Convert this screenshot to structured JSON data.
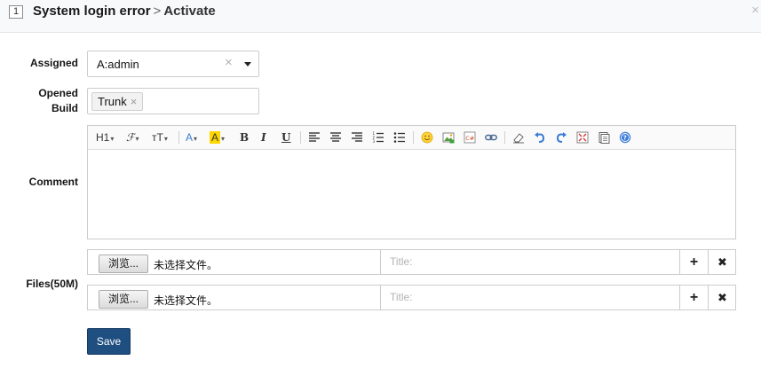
{
  "header": {
    "id": "1",
    "title": "System login error",
    "separator": ">",
    "action": "Activate",
    "close_glyph": "×"
  },
  "form": {
    "assigned": {
      "label": "Assigned",
      "value": "A:admin",
      "clear_glyph": "×"
    },
    "opened_build": {
      "label_line1": "Opened",
      "label_line2": "Build",
      "tags": [
        "Trunk"
      ],
      "tag_remove_glyph": "×"
    },
    "comment": {
      "label": "Comment"
    },
    "files": {
      "label": "Files(50M)",
      "rows": [
        {
          "browse_label": "浏览...",
          "status": "未选择文件。",
          "title_placeholder": "Title:",
          "add": "+",
          "remove": "✖"
        },
        {
          "browse_label": "浏览...",
          "status": "未选择文件。",
          "title_placeholder": "Title:",
          "add": "+",
          "remove": "✖"
        }
      ]
    },
    "save_label": "Save"
  },
  "toolbar": {
    "heading": "H1",
    "font_family": "ℱ",
    "font_size": "тT",
    "fore_color": "A",
    "back_color": "A",
    "bold": "B",
    "italic": "I",
    "underline": "U",
    "icons": [
      "align-left-icon",
      "align-center-icon",
      "align-right-icon",
      "ordered-list-icon",
      "unordered-list-icon",
      "emoticon-icon",
      "image-icon",
      "code-icon",
      "link-icon",
      "remove-format-icon",
      "undo-icon",
      "redo-icon",
      "fullscreen-icon",
      "paste-icon",
      "help-icon"
    ]
  },
  "colors": {
    "accent": "#1f4e80",
    "highlight": "#ffd700",
    "link_blue": "#3b7bd6"
  }
}
